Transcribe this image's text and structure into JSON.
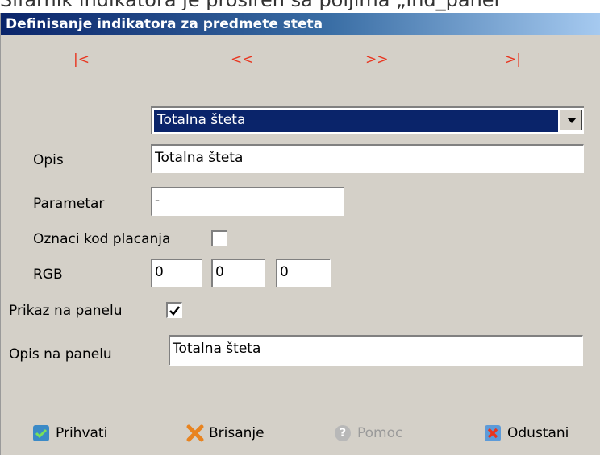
{
  "page_caption": "Sifarnik indikatora je proširen sa poljima „ind_panel“",
  "window": {
    "title": "Definisanje indikatora za predmete steta"
  },
  "nav": {
    "first": "|<",
    "prev": "<<",
    "next": ">>",
    "last": ">|"
  },
  "selector": {
    "value": "Totalna šteta"
  },
  "fields": {
    "opis_label": "Opis",
    "opis_value": "Totalna šteta",
    "parametar_label": "Parametar",
    "parametar_value": "-",
    "oznaci_label": "Oznaci kod placanja",
    "oznaci_checked": false,
    "rgb_label": "RGB",
    "rgb_values": [
      "0",
      "0",
      "0"
    ],
    "prikaz_label": "Prikaz na panelu",
    "prikaz_checked": true,
    "opis_panel_label": "Opis na panelu",
    "opis_panel_value": "Totalna šteta"
  },
  "buttons": {
    "accept": "Prihvati",
    "delete": "Brisanje",
    "help": "Pomoc",
    "cancel": "Odustani"
  },
  "colors": {
    "accent_blue": "#0a246a",
    "nav_red": "#e8351f",
    "panel_bg": "#d4d0c8"
  }
}
